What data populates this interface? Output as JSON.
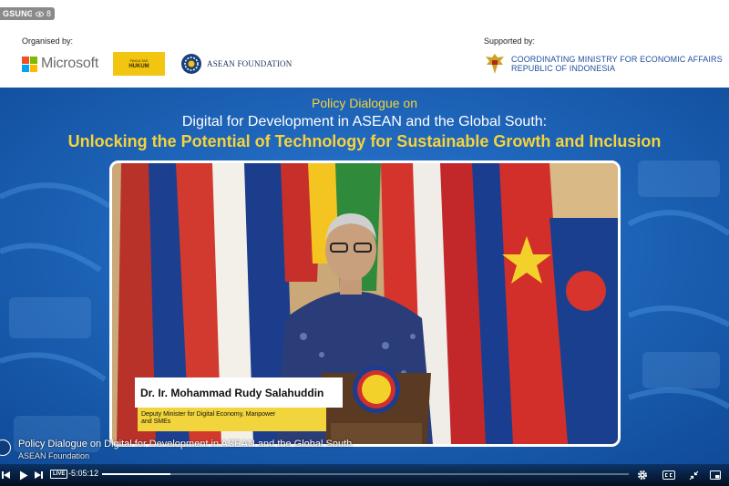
{
  "stream": {
    "channel_tag": "GSUNG",
    "viewer_count": "8"
  },
  "sponsors": {
    "organised_label": "Organised by:",
    "supported_label": "Supported by:",
    "microsoft_name": "Microsoft",
    "hukum_top": "FAKULTAS",
    "hukum_name": "HUKUM",
    "asean_foundation_name": "ASEAN FOUNDATION",
    "ministry_line1": "COORDINATING MINISTRY FOR ECONOMIC AFFAIRS",
    "ministry_line2": "REPUBLIC OF INDONESIA"
  },
  "banner": {
    "line1": "Policy Dialogue on",
    "line2": "Digital for Development in ASEAN and the Global South:",
    "line3": "Unlocking the Potential of Technology for Sustainable Growth and Inclusion"
  },
  "speaker": {
    "name": "Dr. Ir. Mohammad Rudy Salahuddin",
    "role_line1": "Deputy Minister for Digital Economy, Manpower",
    "role_line2": "and SMEs"
  },
  "player": {
    "video_title": "Policy Dialogue on Digital for Development in ASEAN and the Global South",
    "channel_name": "ASEAN Foundation",
    "live_label": "LIVE",
    "time_display": "-5:05:12",
    "progress_fraction": 0.13
  },
  "colors": {
    "banner_blue": "#1b63b8",
    "title_yellow": "#f6d33a",
    "ministry_blue": "#1e4f9c"
  }
}
